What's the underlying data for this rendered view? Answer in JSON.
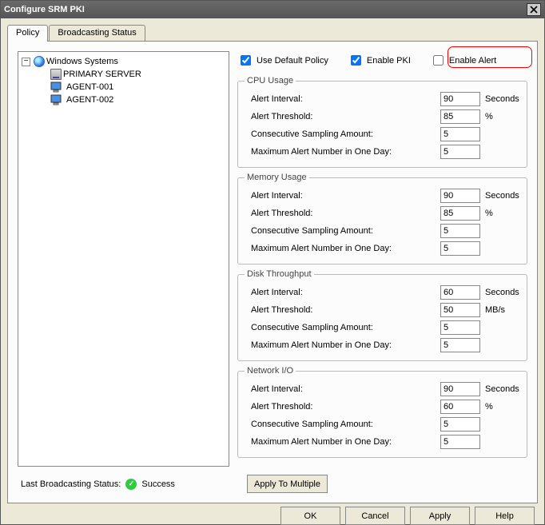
{
  "window": {
    "title": "Configure SRM PKI"
  },
  "tabs": [
    "Policy",
    "Broadcasting Status"
  ],
  "tree": {
    "root": "Windows Systems",
    "children": [
      "PRIMARY SERVER",
      "AGENT-001",
      "AGENT-002"
    ]
  },
  "options": {
    "use_default_policy": "Use Default Policy",
    "use_default_policy_checked": true,
    "enable_pki": "Enable PKI",
    "enable_pki_checked": true,
    "enable_alert": "Enable Alert",
    "enable_alert_checked": false
  },
  "groups": {
    "cpu": {
      "title": "CPU Usage",
      "rows": [
        {
          "label": "Alert Interval:",
          "value": "90",
          "unit": "Seconds"
        },
        {
          "label": "Alert Threshold:",
          "value": "85",
          "unit": "%"
        },
        {
          "label": "Consecutive Sampling Amount:",
          "value": "5",
          "unit": ""
        },
        {
          "label": "Maximum Alert Number in One Day:",
          "value": "5",
          "unit": ""
        }
      ]
    },
    "mem": {
      "title": "Memory Usage",
      "rows": [
        {
          "label": "Alert Interval:",
          "value": "90",
          "unit": "Seconds"
        },
        {
          "label": "Alert Threshold:",
          "value": "85",
          "unit": "%"
        },
        {
          "label": "Consecutive Sampling Amount:",
          "value": "5",
          "unit": ""
        },
        {
          "label": "Maximum Alert Number in One Day:",
          "value": "5",
          "unit": ""
        }
      ]
    },
    "disk": {
      "title": "Disk Throughput",
      "rows": [
        {
          "label": "Alert Interval:",
          "value": "60",
          "unit": "Seconds"
        },
        {
          "label": "Alert Threshold:",
          "value": "50",
          "unit": "MB/s"
        },
        {
          "label": "Consecutive Sampling Amount:",
          "value": "5",
          "unit": ""
        },
        {
          "label": "Maximum Alert Number in One Day:",
          "value": "5",
          "unit": ""
        }
      ]
    },
    "net": {
      "title": "Network I/O",
      "rows": [
        {
          "label": "Alert Interval:",
          "value": "90",
          "unit": "Seconds"
        },
        {
          "label": "Alert Threshold:",
          "value": "60",
          "unit": "%"
        },
        {
          "label": "Consecutive Sampling Amount:",
          "value": "5",
          "unit": ""
        },
        {
          "label": "Maximum Alert Number in One Day:",
          "value": "5",
          "unit": ""
        }
      ]
    }
  },
  "status": {
    "label": "Last Broadcasting Status:",
    "value": "Success"
  },
  "buttons": {
    "apply_multiple": "Apply To Multiple",
    "ok": "OK",
    "cancel": "Cancel",
    "apply": "Apply",
    "help": "Help"
  }
}
